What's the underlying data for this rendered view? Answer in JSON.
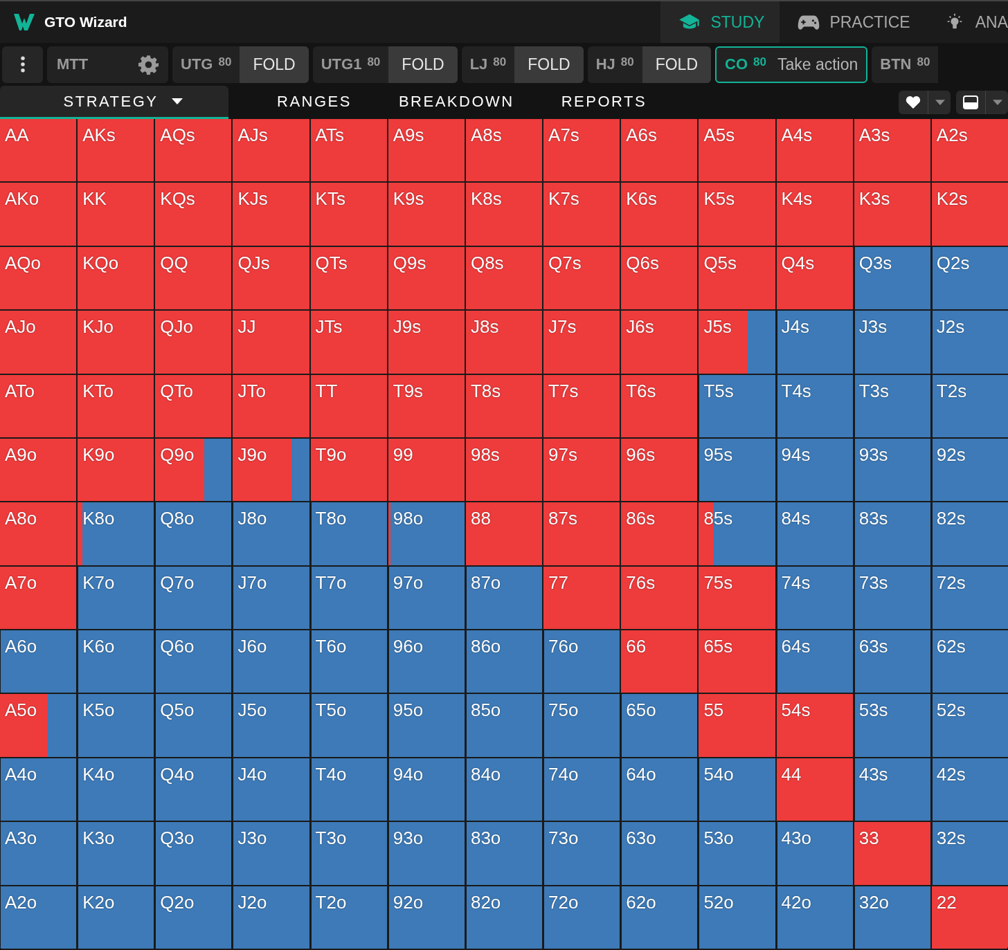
{
  "app": {
    "title": "GTO Wizard"
  },
  "nav": [
    {
      "label": "STUDY",
      "selected": true
    },
    {
      "label": "PRACTICE",
      "selected": false
    },
    {
      "label": "ANA",
      "selected": false
    }
  ],
  "format": {
    "label": "MTT"
  },
  "positions": [
    {
      "name": "UTG",
      "stack": "80",
      "action": "FOLD",
      "selected": false
    },
    {
      "name": "UTG1",
      "stack": "80",
      "action": "FOLD",
      "selected": false
    },
    {
      "name": "LJ",
      "stack": "80",
      "action": "FOLD",
      "selected": false
    },
    {
      "name": "HJ",
      "stack": "80",
      "action": "FOLD",
      "selected": false
    },
    {
      "name": "CO",
      "stack": "80",
      "action": "Take action",
      "selected": true
    },
    {
      "name": "BTN",
      "stack": "80",
      "selected": false
    }
  ],
  "tabs": [
    {
      "label": "STRATEGY",
      "selected": true,
      "dropdown": true
    },
    {
      "label": "RANGES",
      "selected": false,
      "dropdown": false
    },
    {
      "label": "BREAKDOWN",
      "selected": false,
      "dropdown": false
    },
    {
      "label": "REPORTS",
      "selected": false,
      "dropdown": false
    }
  ],
  "grid": [
    [
      {
        "label": "AA",
        "level": 1
      },
      {
        "label": "AKs",
        "level": 1
      },
      {
        "label": "AQs",
        "level": 1
      },
      {
        "label": "AJs",
        "level": 1
      },
      {
        "label": "ATs",
        "level": 1
      },
      {
        "label": "A9s",
        "level": 1
      },
      {
        "label": "A8s",
        "level": 1
      },
      {
        "label": "A7s",
        "level": 1
      },
      {
        "label": "A6s",
        "level": 1
      },
      {
        "label": "A5s",
        "level": 1
      },
      {
        "label": "A4s",
        "level": 1
      },
      {
        "label": "A3s",
        "level": 1
      },
      {
        "label": "A2s",
        "level": 1
      }
    ],
    [
      {
        "label": "AKo",
        "level": 1
      },
      {
        "label": "KK",
        "level": 1
      },
      {
        "label": "KQs",
        "level": 1
      },
      {
        "label": "KJs",
        "level": 1
      },
      {
        "label": "KTs",
        "level": 1
      },
      {
        "label": "K9s",
        "level": 1
      },
      {
        "label": "K8s",
        "level": 1
      },
      {
        "label": "K7s",
        "level": 1
      },
      {
        "label": "K6s",
        "level": 1
      },
      {
        "label": "K5s",
        "level": 1
      },
      {
        "label": "K4s",
        "level": 1
      },
      {
        "label": "K3s",
        "level": 1
      },
      {
        "label": "K2s",
        "level": 1
      }
    ],
    [
      {
        "label": "AQo",
        "level": 1
      },
      {
        "label": "KQo",
        "level": 1
      },
      {
        "label": "QQ",
        "level": 1
      },
      {
        "label": "QJs",
        "level": 1
      },
      {
        "label": "QTs",
        "level": 1
      },
      {
        "label": "Q9s",
        "level": 1
      },
      {
        "label": "Q8s",
        "level": 1
      },
      {
        "label": "Q7s",
        "level": 1
      },
      {
        "label": "Q6s",
        "level": 1
      },
      {
        "label": "Q5s",
        "level": 1
      },
      {
        "label": "Q4s",
        "level": 1
      },
      {
        "label": "Q3s",
        "level": 0
      },
      {
        "label": "Q2s",
        "level": 0
      }
    ],
    [
      {
        "label": "AJo",
        "level": 1
      },
      {
        "label": "KJo",
        "level": 1
      },
      {
        "label": "QJo",
        "level": 1
      },
      {
        "label": "JJ",
        "level": 1
      },
      {
        "label": "JTs",
        "level": 1
      },
      {
        "label": "J9s",
        "level": 1
      },
      {
        "label": "J8s",
        "level": 1
      },
      {
        "label": "J7s",
        "level": 1
      },
      {
        "label": "J6s",
        "level": 1
      },
      {
        "label": "J5s",
        "level": 0.64
      },
      {
        "label": "J4s",
        "level": 0
      },
      {
        "label": "J3s",
        "level": 0
      },
      {
        "label": "J2s",
        "level": 0
      }
    ],
    [
      {
        "label": "ATo",
        "level": 1
      },
      {
        "label": "KTo",
        "level": 1
      },
      {
        "label": "QTo",
        "level": 1
      },
      {
        "label": "JTo",
        "level": 1
      },
      {
        "label": "TT",
        "level": 1
      },
      {
        "label": "T9s",
        "level": 1
      },
      {
        "label": "T8s",
        "level": 1
      },
      {
        "label": "T7s",
        "level": 1
      },
      {
        "label": "T6s",
        "level": 1
      },
      {
        "label": "T5s",
        "level": 0
      },
      {
        "label": "T4s",
        "level": 0
      },
      {
        "label": "T3s",
        "level": 0
      },
      {
        "label": "T2s",
        "level": 0
      }
    ],
    [
      {
        "label": "A9o",
        "level": 1
      },
      {
        "label": "K9o",
        "level": 1
      },
      {
        "label": "Q9o",
        "level": 0.64
      },
      {
        "label": "J9o",
        "level": 0.77
      },
      {
        "label": "T9o",
        "level": 1
      },
      {
        "label": "99",
        "level": 1
      },
      {
        "label": "98s",
        "level": 1
      },
      {
        "label": "97s",
        "level": 1
      },
      {
        "label": "96s",
        "level": 1
      },
      {
        "label": "95s",
        "level": 0
      },
      {
        "label": "94s",
        "level": 0
      },
      {
        "label": "93s",
        "level": 0
      },
      {
        "label": "92s",
        "level": 0
      }
    ],
    [
      {
        "label": "A8o",
        "level": 1
      },
      {
        "label": "K8o",
        "level": 0.06
      },
      {
        "label": "Q8o",
        "level": 0
      },
      {
        "label": "J8o",
        "level": 0
      },
      {
        "label": "T8o",
        "level": 0
      },
      {
        "label": "98o",
        "level": 0.03
      },
      {
        "label": "88",
        "level": 1
      },
      {
        "label": "87s",
        "level": 1
      },
      {
        "label": "86s",
        "level": 1
      },
      {
        "label": "85s",
        "level": 0.2
      },
      {
        "label": "84s",
        "level": 0
      },
      {
        "label": "83s",
        "level": 0
      },
      {
        "label": "82s",
        "level": 0
      }
    ],
    [
      {
        "label": "A7o",
        "level": 1
      },
      {
        "label": "K7o",
        "level": 0
      },
      {
        "label": "Q7o",
        "level": 0
      },
      {
        "label": "J7o",
        "level": 0
      },
      {
        "label": "T7o",
        "level": 0
      },
      {
        "label": "97o",
        "level": 0
      },
      {
        "label": "87o",
        "level": 0
      },
      {
        "label": "77",
        "level": 1
      },
      {
        "label": "76s",
        "level": 1
      },
      {
        "label": "75s",
        "level": 1
      },
      {
        "label": "74s",
        "level": 0
      },
      {
        "label": "73s",
        "level": 0
      },
      {
        "label": "72s",
        "level": 0
      }
    ],
    [
      {
        "label": "A6o",
        "level": 0
      },
      {
        "label": "K6o",
        "level": 0
      },
      {
        "label": "Q6o",
        "level": 0
      },
      {
        "label": "J6o",
        "level": 0
      },
      {
        "label": "T6o",
        "level": 0
      },
      {
        "label": "96o",
        "level": 0
      },
      {
        "label": "86o",
        "level": 0
      },
      {
        "label": "76o",
        "level": 0
      },
      {
        "label": "66",
        "level": 1
      },
      {
        "label": "65s",
        "level": 1
      },
      {
        "label": "64s",
        "level": 0
      },
      {
        "label": "63s",
        "level": 0
      },
      {
        "label": "62s",
        "level": 0
      }
    ],
    [
      {
        "label": "A5o",
        "level": 0.63
      },
      {
        "label": "K5o",
        "level": 0
      },
      {
        "label": "Q5o",
        "level": 0
      },
      {
        "label": "J5o",
        "level": 0
      },
      {
        "label": "T5o",
        "level": 0
      },
      {
        "label": "95o",
        "level": 0
      },
      {
        "label": "85o",
        "level": 0
      },
      {
        "label": "75o",
        "level": 0
      },
      {
        "label": "65o",
        "level": 0
      },
      {
        "label": "55",
        "level": 1
      },
      {
        "label": "54s",
        "level": 1
      },
      {
        "label": "53s",
        "level": 0
      },
      {
        "label": "52s",
        "level": 0
      }
    ],
    [
      {
        "label": "A4o",
        "level": 0
      },
      {
        "label": "K4o",
        "level": 0
      },
      {
        "label": "Q4o",
        "level": 0
      },
      {
        "label": "J4o",
        "level": 0
      },
      {
        "label": "T4o",
        "level": 0
      },
      {
        "label": "94o",
        "level": 0
      },
      {
        "label": "84o",
        "level": 0
      },
      {
        "label": "74o",
        "level": 0
      },
      {
        "label": "64o",
        "level": 0
      },
      {
        "label": "54o",
        "level": 0
      },
      {
        "label": "44",
        "level": 1
      },
      {
        "label": "43s",
        "level": 0
      },
      {
        "label": "42s",
        "level": 0
      }
    ],
    [
      {
        "label": "A3o",
        "level": 0
      },
      {
        "label": "K3o",
        "level": 0
      },
      {
        "label": "Q3o",
        "level": 0
      },
      {
        "label": "J3o",
        "level": 0
      },
      {
        "label": "T3o",
        "level": 0
      },
      {
        "label": "93o",
        "level": 0
      },
      {
        "label": "83o",
        "level": 0
      },
      {
        "label": "73o",
        "level": 0
      },
      {
        "label": "63o",
        "level": 0
      },
      {
        "label": "53o",
        "level": 0
      },
      {
        "label": "43o",
        "level": 0
      },
      {
        "label": "33",
        "level": 1
      },
      {
        "label": "32s",
        "level": 0
      }
    ],
    [
      {
        "label": "A2o",
        "level": 0
      },
      {
        "label": "K2o",
        "level": 0
      },
      {
        "label": "Q2o",
        "level": 0
      },
      {
        "label": "J2o",
        "level": 0
      },
      {
        "label": "T2o",
        "level": 0
      },
      {
        "label": "92o",
        "level": 0
      },
      {
        "label": "82o",
        "level": 0
      },
      {
        "label": "72o",
        "level": 0
      },
      {
        "label": "62o",
        "level": 0
      },
      {
        "label": "52o",
        "level": 0
      },
      {
        "label": "42o",
        "level": 0
      },
      {
        "label": "32o",
        "level": 0
      },
      {
        "label": "22",
        "level": 1
      }
    ]
  ]
}
